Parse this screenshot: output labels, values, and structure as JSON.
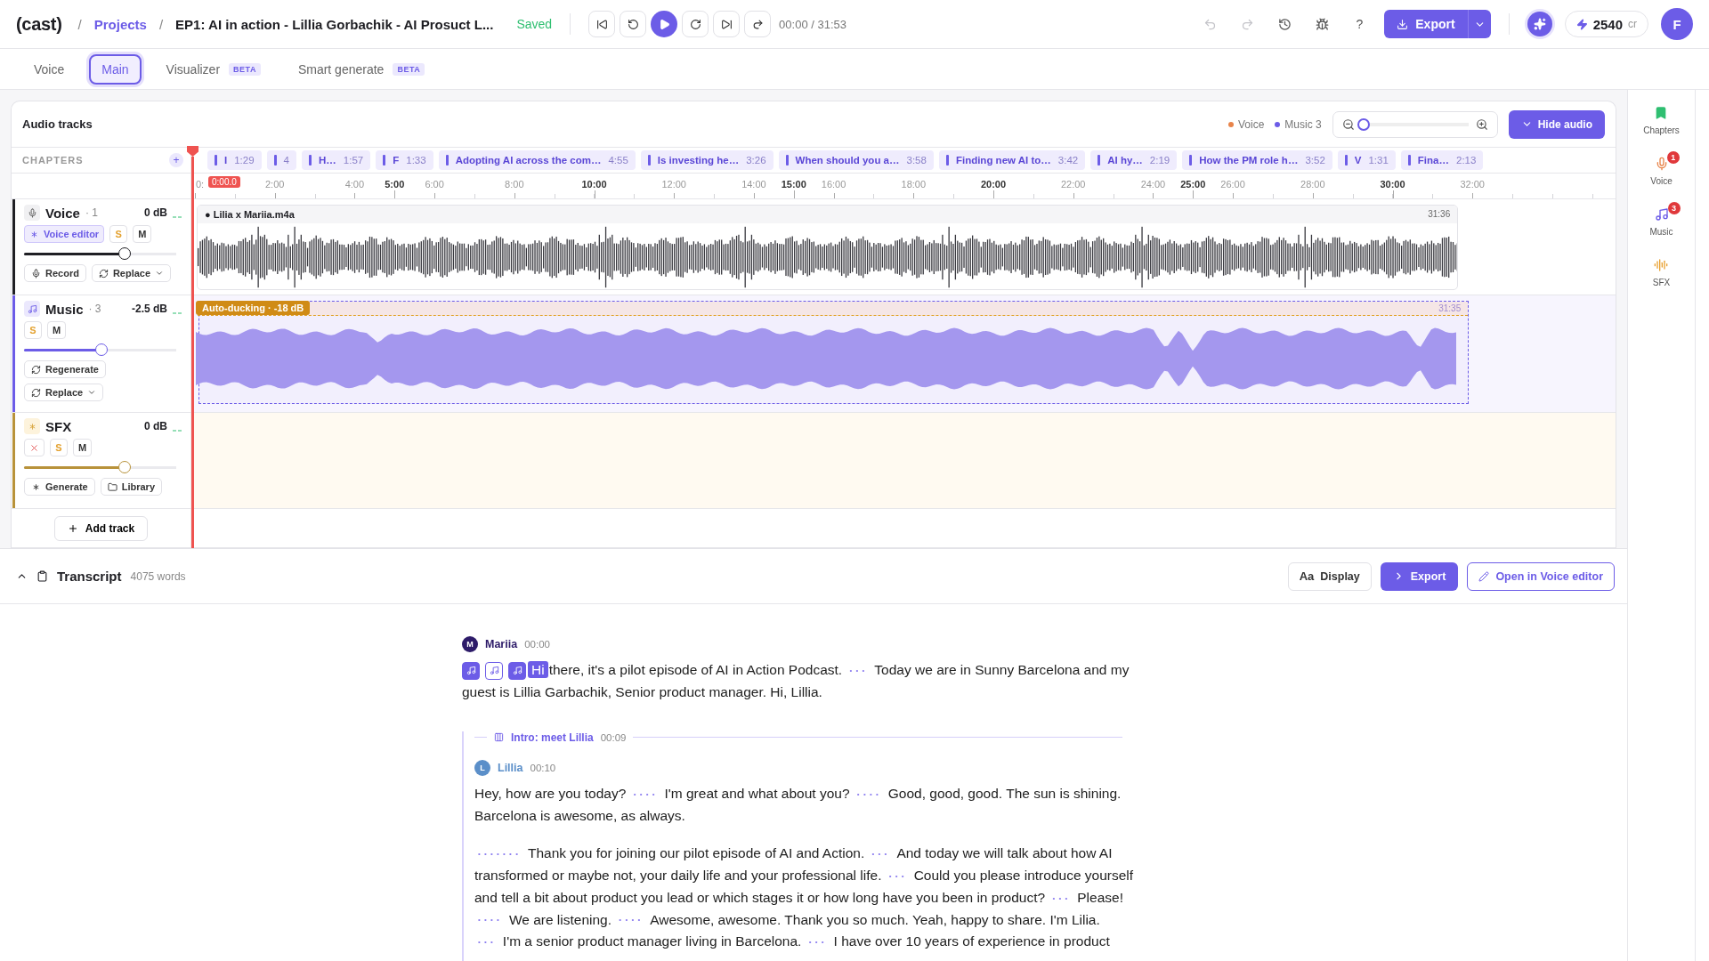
{
  "header": {
    "logo": "(cast)",
    "breadcrumb": [
      {
        "kind": "sep",
        "text": "/"
      },
      {
        "kind": "link",
        "text": "Projects"
      },
      {
        "kind": "sep",
        "text": "/"
      },
      {
        "kind": "title",
        "text": "EP1: AI in action - Lillia Gorbachik - AI Prosuct L..."
      }
    ],
    "status": "Saved",
    "time": "00:00 / 31:53",
    "help": "?",
    "export": "Export",
    "credits": "2540",
    "credits_unit": "cr",
    "avatar": "F"
  },
  "tabs": [
    {
      "label": "Voice",
      "selected": false
    },
    {
      "label": "Main",
      "selected": true
    },
    {
      "label": "Visualizer",
      "badge": "BETA",
      "selected": false
    },
    {
      "label": "Smart generate",
      "badge": "BETA",
      "selected": false
    }
  ],
  "audio": {
    "title": "Audio tracks",
    "legend": [
      {
        "label": "Voice",
        "color": "#e8844a"
      },
      {
        "label": "Music 3",
        "color": "#6c5ce7"
      }
    ],
    "zoom": {
      "level": 0.02
    },
    "hide": "Hide audio"
  },
  "chapters": {
    "label": "CHAPTERS",
    "add": "+",
    "items": [
      {
        "title": "I",
        "time": "1:29"
      },
      {
        "time": "4"
      },
      {
        "title": "H…",
        "time": "1:57"
      },
      {
        "title": "F",
        "time": "1:33"
      },
      {
        "title": "Adopting AI across the com…",
        "time": "4:55"
      },
      {
        "title": "Is investing he…",
        "time": "3:26"
      },
      {
        "title": "When should you a…",
        "time": "3:58"
      },
      {
        "title": "Finding new AI to…",
        "time": "3:42"
      },
      {
        "title": "AI hy…",
        "time": "2:19"
      },
      {
        "title": "How the PM role h…",
        "time": "3:52"
      },
      {
        "title": "V",
        "time": "1:31"
      },
      {
        "title": "Fina…",
        "time": "2:13"
      }
    ]
  },
  "ruler": {
    "playhead": "0:00.0",
    "ticks": [
      {
        "label": "0:",
        "major": false
      },
      {
        "label": "2:00",
        "major": false
      },
      {
        "label": "4:00",
        "major": false
      },
      {
        "label": "5:00",
        "major": true
      },
      {
        "label": "6:00",
        "major": false
      },
      {
        "label": "8:00",
        "major": false
      },
      {
        "label": "10:00",
        "major": true
      },
      {
        "label": "12:00",
        "major": false
      },
      {
        "label": "14:00",
        "major": false
      },
      {
        "label": "15:00",
        "major": true
      },
      {
        "label": "16:00",
        "major": false
      },
      {
        "label": "18:00",
        "major": false
      },
      {
        "label": "20:00",
        "major": true
      },
      {
        "label": "22:00",
        "major": false
      },
      {
        "label": "24:00",
        "major": false
      },
      {
        "label": "25:00",
        "major": true
      },
      {
        "label": "26:00",
        "major": false
      },
      {
        "label": "28:00",
        "major": false
      },
      {
        "label": "30:00",
        "major": true
      },
      {
        "label": "32:00",
        "major": false
      }
    ]
  },
  "tracks": [
    {
      "kind": "voice",
      "name": "Voice",
      "count": "· 1",
      "gain": "0 dB",
      "color": "#1f1f24",
      "level": 0.66,
      "controls": [
        {
          "kind": "editor",
          "label": "Voice editor"
        },
        {
          "kind": "solo",
          "label": "S"
        },
        {
          "kind": "mute",
          "label": "M"
        }
      ],
      "actions": [
        {
          "kind": "record",
          "label": "Record"
        },
        {
          "kind": "replace",
          "label": "Replace"
        }
      ],
      "clip": {
        "name": "● Lilia x Mariia.m4a",
        "duration": "31:36"
      }
    },
    {
      "kind": "music",
      "name": "Music",
      "count": "· 3",
      "gain": "-2.5 dB",
      "color": "#6c5ce7",
      "level": 0.51,
      "controls": [
        {
          "kind": "solo",
          "label": "S"
        },
        {
          "kind": "mute",
          "label": "M"
        }
      ],
      "actions": [
        {
          "kind": "regenerate",
          "label": "Regenerate"
        },
        {
          "kind": "replace",
          "label": "Replace"
        }
      ],
      "clip": {
        "badge": "Auto-ducking · -18 dB",
        "duration": "31:35"
      }
    },
    {
      "kind": "sfx",
      "name": "SFX",
      "gain": "0 dB",
      "color": "#b8923a",
      "level": 0.66,
      "controls": [
        {
          "kind": "remove"
        },
        {
          "kind": "solo",
          "label": "S"
        },
        {
          "kind": "mute",
          "label": "M"
        }
      ],
      "actions": [
        {
          "kind": "generate",
          "label": "Generate"
        },
        {
          "kind": "library",
          "label": "Library"
        }
      ]
    }
  ],
  "add_track": "Add track",
  "sidebar": [
    {
      "kind": "chapters",
      "label": "Chapters"
    },
    {
      "kind": "voice",
      "label": "Voice",
      "badge": "1"
    },
    {
      "kind": "music",
      "label": "Music",
      "badge": "3"
    },
    {
      "kind": "sfx",
      "label": "SFX"
    }
  ],
  "transcript": {
    "title": "Transcript",
    "count": "4075 words",
    "display_icon": "Aa",
    "display": "Display",
    "export": "Export",
    "open": "Open in Voice editor",
    "blocks": [
      {
        "kind": "speech",
        "speaker": "Mariia",
        "initial": "M",
        "color": "#2d1b69",
        "time": "00:00",
        "paragraphs": [
          [
            {
              "kind": "music",
              "selected": true
            },
            {
              "kind": "music",
              "selected": false
            },
            {
              "kind": "music",
              "selected": true
            },
            {
              "kind": "word",
              "text": "Hi"
            },
            {
              "kind": "text",
              "text": "there, it's a pilot episode of AI in Action Podcast."
            },
            {
              "kind": "pause",
              "text": "• • •"
            },
            {
              "kind": "text",
              "text": "Today we are in Sunny Barcelona and my"
            },
            {
              "kind": "text",
              "text": "guest is Lillia Garbachik, Senior product manager. Hi, Lillia."
            }
          ]
        ]
      },
      {
        "kind": "chapter",
        "title": "Intro: meet Lillia",
        "time": "00:09",
        "children": [
          {
            "kind": "speech",
            "speaker": "Lillia",
            "initial": "L",
            "color": "#5b8fc9",
            "time": "00:10",
            "paragraphs": [
              [
                {
                  "kind": "text",
                  "text": "Hey, how are you today?"
                },
                {
                  "kind": "pause",
                  "text": "• • • •"
                },
                {
                  "kind": "text",
                  "text": "I'm great and what about you?"
                },
                {
                  "kind": "pause",
                  "text": "• • • •"
                },
                {
                  "kind": "text",
                  "text": "Good, good, good. The sun is shining."
                },
                {
                  "kind": "text",
                  "text": "Barcelona is awesome, as always."
                }
              ],
              [
                {
                  "kind": "pause",
                  "text": "• • • • • • •"
                },
                {
                  "kind": "text",
                  "text": "Thank you for joining our pilot episode of AI and Action."
                },
                {
                  "kind": "pause",
                  "text": "• • •"
                },
                {
                  "kind": "text",
                  "text": "And today we will talk about how AI"
                },
                {
                  "kind": "text",
                  "text": "transformed or maybe not, your daily life and your professional life."
                },
                {
                  "kind": "pause",
                  "text": "• • •"
                },
                {
                  "kind": "text",
                  "text": "Could you please introduce yourself"
                },
                {
                  "kind": "text",
                  "text": "and tell a bit about product you lead or which stages it or how long have you been in product?"
                },
                {
                  "kind": "pause",
                  "text": "• • •"
                },
                {
                  "kind": "text",
                  "text": "Please!"
                },
                {
                  "kind": "pause",
                  "text": "• • • •"
                },
                {
                  "kind": "text",
                  "text": "We are listening."
                },
                {
                  "kind": "pause",
                  "text": "• • • •"
                },
                {
                  "kind": "text",
                  "text": "Awesome, awesome. Thank you so much. Yeah, happy to share. I'm Lilia."
                },
                {
                  "kind": "pause",
                  "text": "• • •"
                },
                {
                  "kind": "text",
                  "text": "I'm a senior product manager living in Barcelona."
                },
                {
                  "kind": "pause",
                  "text": "• • •"
                },
                {
                  "kind": "text",
                  "text": "I have over 10 years of experience in product"
                }
              ]
            ]
          }
        ]
      }
    ]
  }
}
